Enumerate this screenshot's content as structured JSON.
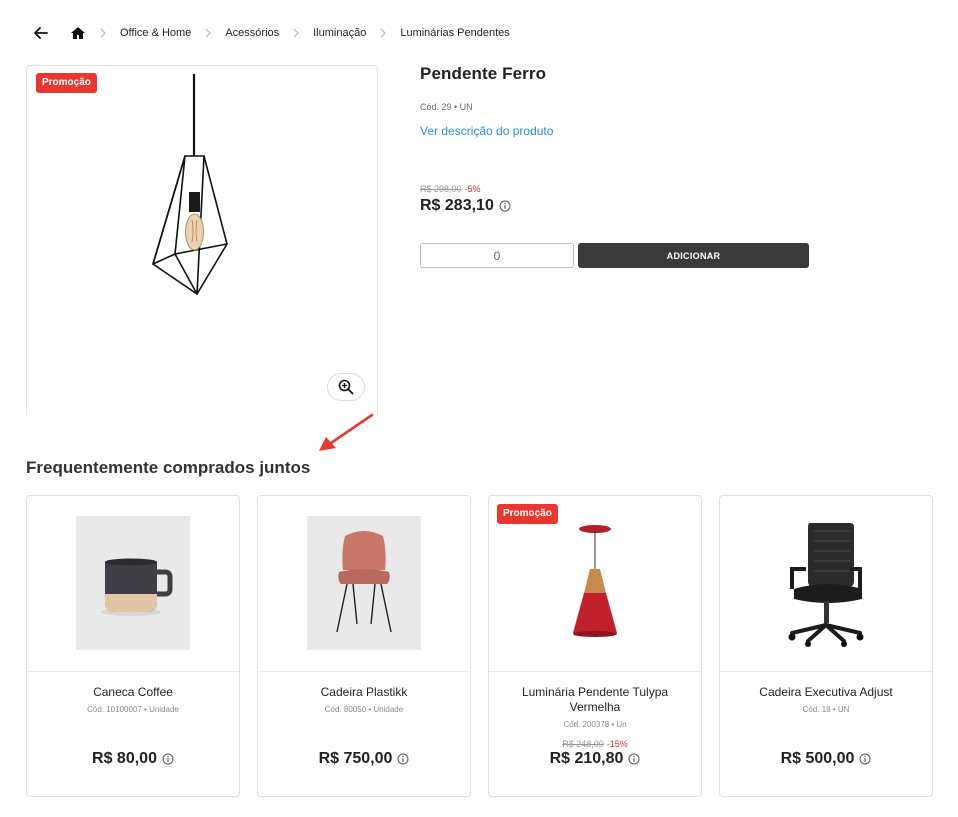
{
  "breadcrumb": {
    "items": [
      "Office & Home",
      "Acessórios",
      "Iluminação",
      "Luminárias Pendentes"
    ]
  },
  "product": {
    "promo_badge": "Promoção",
    "title": "Pendente Ferro",
    "code": "Cód. 29 • UN",
    "description_link": "Ver descrição do produto",
    "old_price": "R$ 298,00",
    "discount": "-5%",
    "price": "R$ 283,10",
    "quantity": "0",
    "add_button": "ADICIONAR"
  },
  "related": {
    "title": "Frequentemente comprados juntos",
    "items": [
      {
        "name": "Caneca Coffee",
        "code": "Cód. 10100007 • Unidade",
        "price": "R$ 80,00"
      },
      {
        "name": "Cadeira Plastikk",
        "code": "Cód. 80050 • Unidade",
        "price": "R$ 750,00"
      },
      {
        "badge": "Promoção",
        "name": "Luminária Pendente Tulypa Vermelha",
        "code": "Cód. 200378 • Un",
        "old_price": "R$ 248,00",
        "discount": "-15%",
        "price": "R$ 210,80"
      },
      {
        "name": "Cadeira Executiva Adjust",
        "code": "Cód. 18 • UN",
        "price": "R$ 500,00"
      }
    ]
  },
  "colors": {
    "promo": "#e8372e",
    "link": "#2d8fd6",
    "button": "#3a3a3a",
    "annotation_arrow": "#e53935"
  },
  "icons": [
    "back-arrow-icon",
    "home-icon",
    "chevron-right-icon",
    "zoom-in-icon",
    "info-icon"
  ]
}
